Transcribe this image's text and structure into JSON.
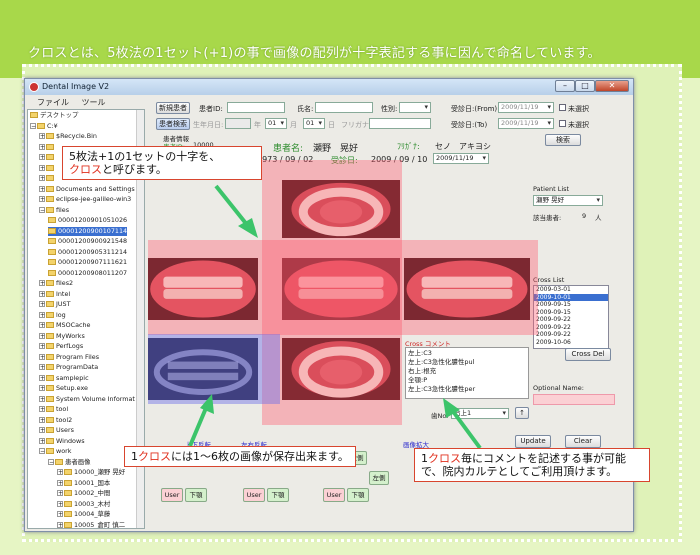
{
  "banner": {
    "text": "クロスとは、5枚法の1セット(+1)の事で画像の配列が十字表記する事に因んで命名しています。"
  },
  "window": {
    "title": "Dental Image V2",
    "controls": {
      "minimize": "–",
      "maximize": "□",
      "close": "✕"
    }
  },
  "menu": [
    "ファイル",
    "ツール"
  ],
  "tree": {
    "items": [
      {
        "label": "デスクトップ",
        "depth": 0,
        "sign": ""
      },
      {
        "label": "C:¥",
        "depth": 0,
        "sign": "−"
      },
      {
        "label": "$Recycle.Bin",
        "depth": 1,
        "sign": "+"
      },
      {
        "label": "",
        "depth": 1,
        "sign": "+"
      },
      {
        "label": "",
        "depth": 1,
        "sign": "+"
      },
      {
        "label": "",
        "depth": 1,
        "sign": "+"
      },
      {
        "label": "",
        "depth": 1,
        "sign": "+"
      },
      {
        "label": "Documents and Settings",
        "depth": 1,
        "sign": "+"
      },
      {
        "label": "eclipse-jee-galileo-win3",
        "depth": 1,
        "sign": "+"
      },
      {
        "label": "files",
        "depth": 1,
        "sign": "−"
      },
      {
        "label": "00001200901051026",
        "depth": 2,
        "sign": ""
      },
      {
        "label": "00001200900107114",
        "depth": 2,
        "sign": "",
        "selected": true
      },
      {
        "label": "00001200900921548",
        "depth": 2,
        "sign": ""
      },
      {
        "label": "00001200905311214",
        "depth": 2,
        "sign": ""
      },
      {
        "label": "00001200907111621",
        "depth": 2,
        "sign": ""
      },
      {
        "label": "00001200908011207",
        "depth": 2,
        "sign": ""
      },
      {
        "label": "files2",
        "depth": 1,
        "sign": "+"
      },
      {
        "label": "Intel",
        "depth": 1,
        "sign": "+"
      },
      {
        "label": "JUST",
        "depth": 1,
        "sign": "+"
      },
      {
        "label": "log",
        "depth": 1,
        "sign": "+"
      },
      {
        "label": "MSOCache",
        "depth": 1,
        "sign": "+"
      },
      {
        "label": "MyWorks",
        "depth": 1,
        "sign": "+"
      },
      {
        "label": "PerfLogs",
        "depth": 1,
        "sign": "+"
      },
      {
        "label": "Program Files",
        "depth": 1,
        "sign": "+"
      },
      {
        "label": "ProgramData",
        "depth": 1,
        "sign": "+"
      },
      {
        "label": "samplepic",
        "depth": 1,
        "sign": "+"
      },
      {
        "label": "Setup.exe",
        "depth": 1,
        "sign": "+"
      },
      {
        "label": "System Volume Informat",
        "depth": 1,
        "sign": "+"
      },
      {
        "label": "tool",
        "depth": 1,
        "sign": "+"
      },
      {
        "label": "tool2",
        "depth": 1,
        "sign": "+"
      },
      {
        "label": "Users",
        "depth": 1,
        "sign": "+"
      },
      {
        "label": "Windows",
        "depth": 1,
        "sign": "+"
      },
      {
        "label": "work",
        "depth": 1,
        "sign": "−"
      },
      {
        "label": "患者画像",
        "depth": 2,
        "sign": "−"
      },
      {
        "label": "10000_瀬野 晃好",
        "depth": 3,
        "sign": "+"
      },
      {
        "label": "10001_国本",
        "depth": 3,
        "sign": "+"
      },
      {
        "label": "10002_中間",
        "depth": 3,
        "sign": "+"
      },
      {
        "label": "10003_木村",
        "depth": 3,
        "sign": "+"
      },
      {
        "label": "10004_草藤",
        "depth": 3,
        "sign": "+"
      },
      {
        "label": "10005_倉町 慎二",
        "depth": 3,
        "sign": "+"
      }
    ]
  },
  "search": {
    "new_patient_btn": "新規患者",
    "patient_id_label": "患者ID:",
    "name_label": "氏名:",
    "sex_label": "性別:",
    "visit_from_label": "受診日:(From)",
    "visit_from_value": "2009/11/19",
    "unselected_label": "未選択",
    "patient_search_btn": "患者検索",
    "birth_label": "生年月日:",
    "year_label": "年",
    "month_value": "01",
    "month_label": "月",
    "day_value": "01",
    "day_label": "日",
    "furigana_label": "フリガナ:",
    "visit_to_label": "受診日:(To)",
    "visit_to_value": "2009/11/19",
    "search_btn": "検索"
  },
  "patient_info": {
    "header": "患者情報",
    "id_label": "患者ID:",
    "id_value": "10000",
    "name_label": "患者名:",
    "name_value": "瀬野　晃好",
    "kana_label": "ﾌﾘｶﾞﾅ:",
    "kana_value": "セノ　アキヨシ",
    "birth_value": "1973 / 09 / 02",
    "visit_label": "受診日:",
    "visit_value": "2009 / 09 / 10",
    "date_picker_value": "2009/11/19"
  },
  "right_panel": {
    "patient_list_label": "Patient List",
    "patient_select_value": "瀬野 晃好",
    "count_label": "該当患者:",
    "count_value": "9",
    "count_unit": "人",
    "cross_list_label": "Cross List",
    "cross_list": [
      "2009-03-01",
      "2009-10-01",
      "2009-09-15",
      "2009-09-15",
      "2009-09-22",
      "2009-09-22",
      "2009-09-22",
      "2009-10-06"
    ],
    "cross_selected_index": 1,
    "cross_del_btn": "Cross Del",
    "optional_name_label": "Optional Name:",
    "update_btn": "Update",
    "clear_btn": "Clear"
  },
  "comment": {
    "label": "Cross コメント",
    "lines": [
      "左上:C3",
      "左上:C3急性化膿性pul",
      "右上:根充",
      "全顎:P",
      "左上:C3急性化膿性per"
    ],
    "tooth_no_label": "歯No.",
    "tooth_select_value": "右上1",
    "up_btn": "↑"
  },
  "bottom_bar": {
    "label_upper": "上下反転",
    "label_left": "左右反転",
    "label_enlarge": "画像拡大",
    "btn_user": "User",
    "btn_download": "下顎",
    "btn_lr": "左側",
    "btn_other": "左側"
  },
  "callouts": {
    "top": [
      "5枚法+1の1セットの十字を、",
      "クロス",
      "と呼びます。"
    ],
    "bottom_left": [
      "1",
      "クロス",
      "には1〜6枚の画像が保存出来ます。"
    ],
    "bottom_right": [
      "1",
      "クロス",
      "毎にコメントを記述する事が可能で、院内カルテとしてご利用頂けます。"
    ]
  },
  "colors": {
    "banner": "#a8d84a",
    "background": "#e6f5c4",
    "cross_overlay": "#ff5a6e",
    "blue_overlay": "#6f6fe8",
    "arrow": "#3cc46a",
    "callout_border": "#d8452e",
    "highlight_text": "#e0301e"
  }
}
